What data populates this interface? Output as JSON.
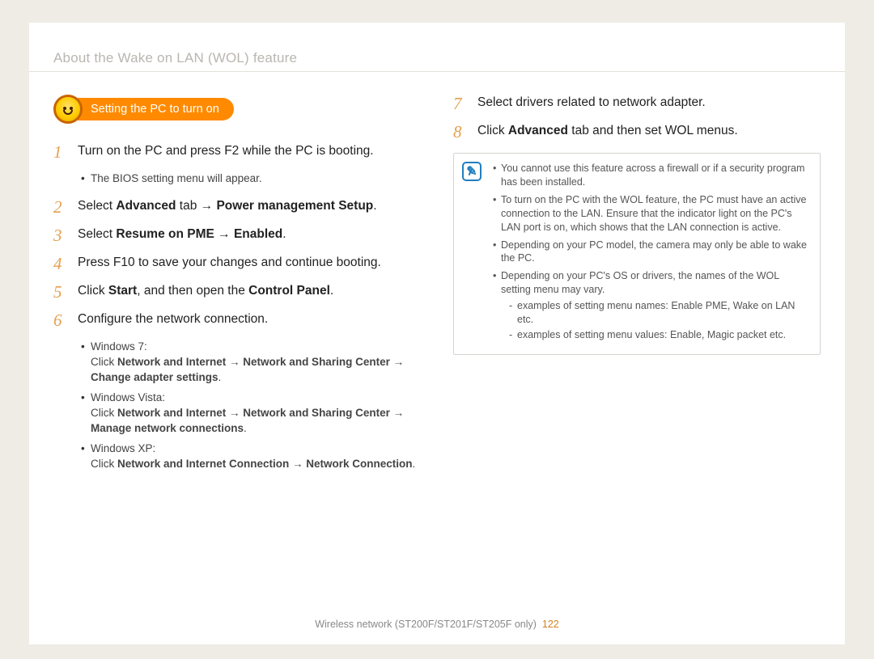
{
  "page_title": "About the Wake on LAN (WOL) feature",
  "pill_label": "Setting the PC to turn on",
  "left_steps": [
    {
      "num": "1",
      "text": "Turn on the PC and press F2 while the PC is booting.",
      "sub": [
        {
          "text": "The BIOS setting menu will appear."
        }
      ]
    },
    {
      "num": "2",
      "html": "Select <b>Advanced</b> tab → <b>Power management Setup</b>."
    },
    {
      "num": "3",
      "html": "Select <b>Resume on PME</b> → <b>Enabled</b>."
    },
    {
      "num": "4",
      "text": "Press F10 to save your changes and continue booting."
    },
    {
      "num": "5",
      "html": "Click <b>Start</b>, and then open the <b>Control Panel</b>."
    },
    {
      "num": "6",
      "text": "Configure the network connection.",
      "sub": [
        {
          "html": "Windows 7:<br>Click <b>Network and Internet</b> → <b>Network and Sharing Center</b> → <b>Change adapter settings</b>."
        },
        {
          "html": "Windows Vista:<br>Click <b>Network and Internet</b> → <b>Network and Sharing Center</b> → <b>Manage network connections</b>."
        },
        {
          "html": "Windows XP:<br>Click <b>Network and Internet Connection</b> → <b>Network Connection</b>."
        }
      ]
    }
  ],
  "right_steps": [
    {
      "num": "7",
      "text": "Select drivers related to network adapter."
    },
    {
      "num": "8",
      "html": "Click <b>Advanced</b> tab and then set WOL menus."
    }
  ],
  "notes": [
    {
      "text": "You cannot use this feature across a firewall or if a security program has been installed."
    },
    {
      "text": "To turn on the PC with the WOL feature, the PC must have an active connection to the LAN. Ensure that the indicator light on the PC's LAN port is on, which shows that the LAN connection is active."
    },
    {
      "text": "Depending on your PC model, the camera may only be able to wake the PC."
    },
    {
      "text": "Depending on your PC's OS or drivers, the names of the WOL setting menu may vary.",
      "sub": [
        "examples of setting menu names: Enable PME, Wake on LAN etc.",
        "examples of setting menu values: Enable, Magic packet etc."
      ]
    }
  ],
  "footer_text": "Wireless network (ST200F/ST201F/ST205F only)",
  "page_number": "122"
}
